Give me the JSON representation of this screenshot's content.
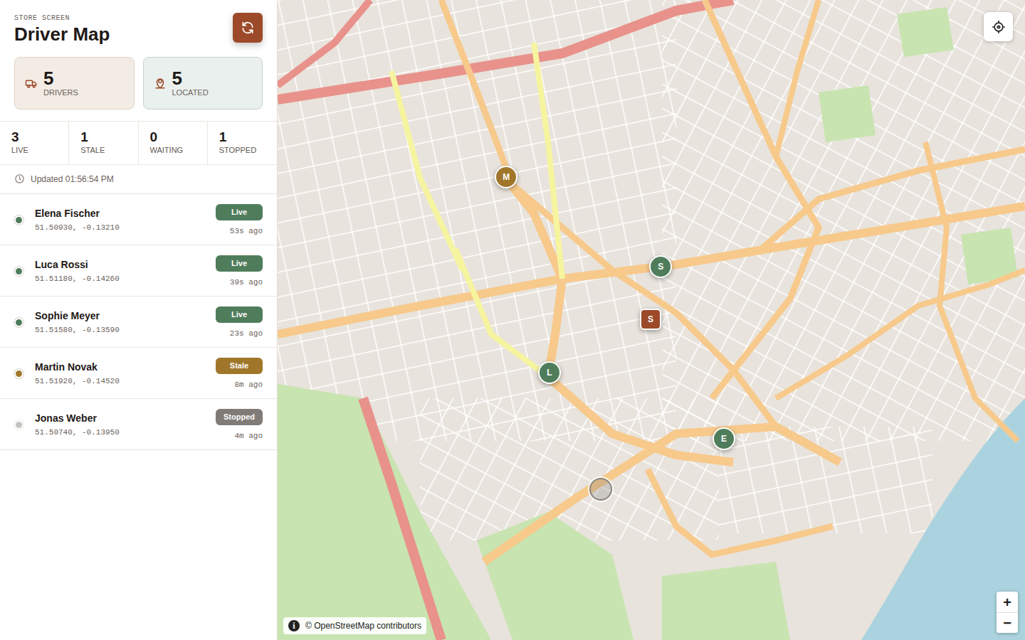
{
  "header": {
    "eyebrow": "STORE SCREEN",
    "title": "Driver Map"
  },
  "summary": [
    {
      "value": "5",
      "label": "DRIVERS",
      "kind": "drivers"
    },
    {
      "value": "5",
      "label": "LOCATED",
      "kind": "located"
    }
  ],
  "counts": [
    {
      "value": "3",
      "label": "LIVE"
    },
    {
      "value": "1",
      "label": "STALE"
    },
    {
      "value": "0",
      "label": "WAITING"
    },
    {
      "value": "1",
      "label": "STOPPED"
    }
  ],
  "updated": "Updated 01:56:54 PM",
  "drivers": [
    {
      "name": "Elena Fischer",
      "coords": "51.50930, -0.13210",
      "status": "Live",
      "ago": "53s ago",
      "kind": "live",
      "color": "#4f7d5b",
      "pin": "E"
    },
    {
      "name": "Luca Rossi",
      "coords": "51.51180, -0.14260",
      "status": "Live",
      "ago": "39s ago",
      "kind": "live",
      "color": "#4f7d5b",
      "pin": "L"
    },
    {
      "name": "Sophie Meyer",
      "coords": "51.51580, -0.13590",
      "status": "Live",
      "ago": "23s ago",
      "kind": "live",
      "color": "#4f7d5b",
      "pin": "S"
    },
    {
      "name": "Martin Novak",
      "coords": "51.51920, -0.14520",
      "status": "Stale",
      "ago": "8m ago",
      "kind": "stale",
      "color": "#a0772a",
      "pin": "M"
    },
    {
      "name": "Jonas Weber",
      "coords": "51.50740, -0.13950",
      "status": "Stopped",
      "ago": "4m ago",
      "kind": "stopped",
      "color": "#807b76"
    }
  ],
  "store_pin": "S",
  "map": {
    "info": "i",
    "attribution": "© OpenStreetMap contributors",
    "zoom_in": "+",
    "zoom_out": "−"
  }
}
